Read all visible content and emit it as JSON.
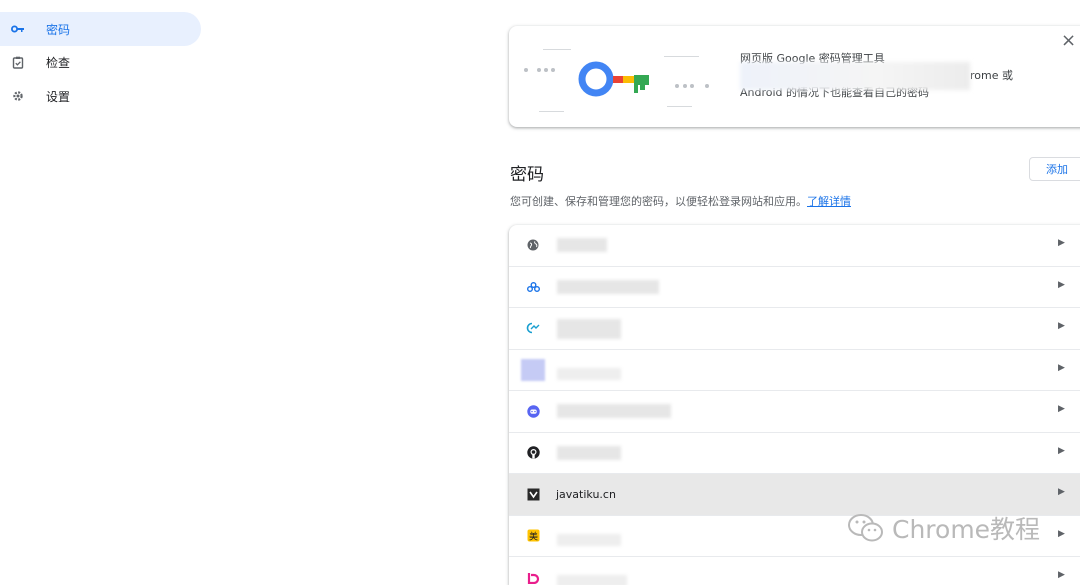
{
  "sidebar": {
    "items": [
      {
        "label": "密码",
        "icon": "key-icon",
        "active": true
      },
      {
        "label": "检查",
        "icon": "checkup-icon",
        "active": false
      },
      {
        "label": "设置",
        "icon": "gear-icon",
        "active": false
      }
    ]
  },
  "promo": {
    "line1": "网页版 Google 密码管理工具",
    "line2_end": "rome 或",
    "line3": "Android 的情况下也能查看自己的密码",
    "close": "×"
  },
  "main": {
    "title": "密码",
    "add_label": "添加",
    "description": "您可创建、保存和管理您的密码，以便轻松登录网站和应用。",
    "learn_more": "了解详情"
  },
  "list": {
    "rows": [
      {
        "icon": "globe-icon",
        "text": ""
      },
      {
        "icon": "site-icon",
        "text": ""
      },
      {
        "icon": "site-icon",
        "text": ""
      },
      {
        "icon": "site-icon",
        "text": ""
      },
      {
        "icon": "discord-icon",
        "text": ""
      },
      {
        "icon": "github-icon",
        "text": ""
      },
      {
        "icon": "javatiku-icon",
        "text": "javatiku.cn"
      },
      {
        "icon": "meituan-icon",
        "text": ""
      },
      {
        "icon": "site-icon",
        "text": ""
      }
    ]
  },
  "watermark": {
    "text": "Chrome教程"
  },
  "colors": {
    "accent": "#1a73e8",
    "active_bg": "#e8f0fe",
    "selected_row": "#e8e8e8"
  }
}
